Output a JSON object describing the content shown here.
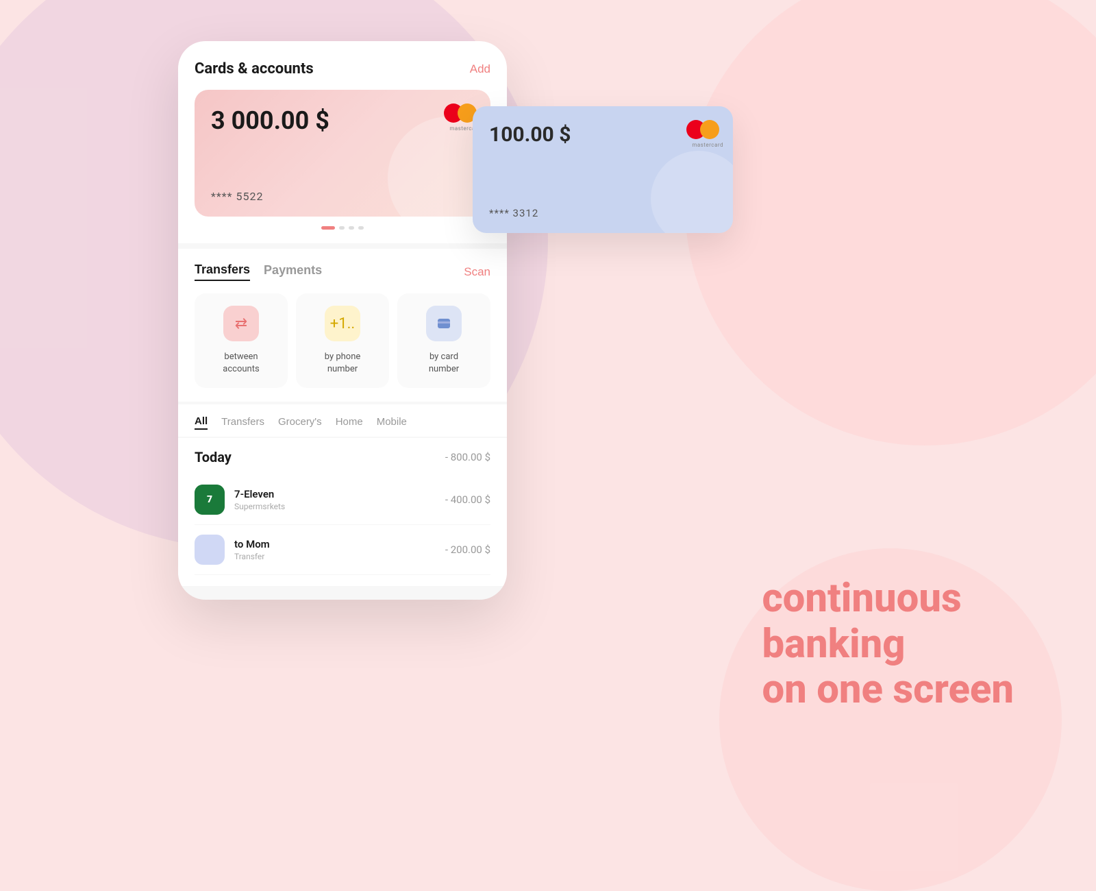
{
  "background": {
    "color": "#fce4e4"
  },
  "cards_section": {
    "title": "Cards & accounts",
    "add_button": "Add"
  },
  "main_card": {
    "amount": "3 000.00 $",
    "card_number": "**** 5522",
    "brand": "mastercard"
  },
  "second_card": {
    "amount": "100.00 $",
    "card_number": "**** 3312",
    "brand": "mastercard"
  },
  "tabs": {
    "transfers_label": "Transfers",
    "payments_label": "Payments",
    "scan_label": "Scan"
  },
  "transfer_options": [
    {
      "icon": "⇄",
      "label": "between\naccounts",
      "style": "pink"
    },
    {
      "icon": "+1..",
      "label": "by phone\nnumber",
      "style": "yellow"
    },
    {
      "icon": "▣",
      "label": "by card\nnumber",
      "style": "blue"
    }
  ],
  "filter_tabs": [
    "All",
    "Transfers",
    "Grocery's",
    "Home",
    "Mobile"
  ],
  "transactions": {
    "period_label": "Today",
    "period_total": "- 800.00 $",
    "items": [
      {
        "name": "7-Eleven",
        "sub": "Supermsrkets",
        "amount": "- 400.00 $",
        "icon_type": "seven-eleven"
      },
      {
        "name": "to Mom",
        "sub": "Transfer",
        "amount": "- 200.00 $",
        "icon_type": "avatar"
      }
    ]
  },
  "tagline": {
    "line1": "continuous",
    "line2": "banking",
    "line3": "on one screen"
  }
}
